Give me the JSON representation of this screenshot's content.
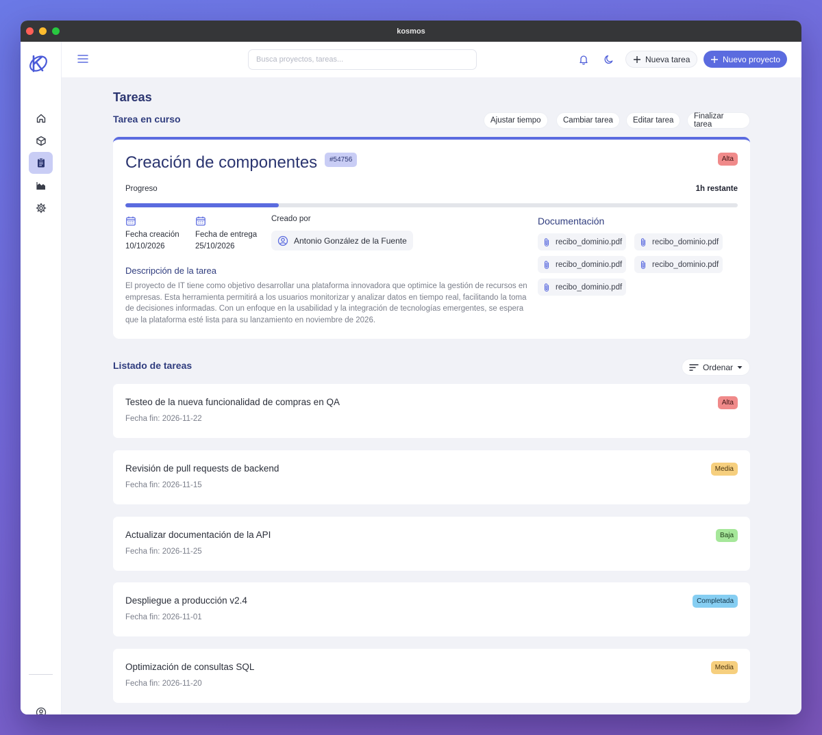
{
  "window": {
    "title": "kosmos"
  },
  "topbar": {
    "search_placeholder": "Busca proyectos, tareas...",
    "new_task_label": "Nueva tarea",
    "new_project_label": "Nuevo proyecto"
  },
  "sidebar": {
    "items": [
      {
        "name": "home",
        "icon": "home-icon",
        "active": false
      },
      {
        "name": "projects",
        "icon": "cube-icon",
        "active": false
      },
      {
        "name": "tasks",
        "icon": "clipboard-icon",
        "active": true
      },
      {
        "name": "reports",
        "icon": "chart-area-icon",
        "active": false
      },
      {
        "name": "settings",
        "icon": "gear-icon",
        "active": false
      }
    ],
    "account_icon": "user-circle-icon"
  },
  "page": {
    "title": "Tareas",
    "current_section": "Tarea en curso",
    "actions": [
      "Ajustar tiempo",
      "Cambiar tarea",
      "Editar tarea",
      "Finalizar tarea"
    ]
  },
  "current_task": {
    "title": "Creación de componentes",
    "id": "#54756",
    "priority": "Alta",
    "progress_label": "Progreso",
    "remaining": "1h restante",
    "progress_fraction": 0.25,
    "created_label": "Fecha creación",
    "created_date": "10/10/2026",
    "due_label": "Fecha de entrega",
    "due_date": "25/10/2026",
    "creator_label": "Creado por",
    "creator_name": "Antonio González de la Fuente",
    "description_title": "Descripción de la tarea",
    "description": "El proyecto de IT tiene como objetivo desarrollar una plataforma innovadora que optimice la gestión de recursos en empresas. Esta herramienta permitirá a los usuarios monitorizar y analizar datos en tiempo real, facilitando la toma de decisiones informadas. Con un enfoque en la usabilidad y la integración de tecnologías emergentes, se espera que la plataforma esté lista para su lanzamiento en noviembre de 2026.",
    "documentation_title": "Documentación",
    "documents": [
      "recibo_dominio.pdf",
      "recibo_dominio.pdf",
      "recibo_dominio.pdf",
      "recibo_dominio.pdf",
      "recibo_dominio.pdf"
    ]
  },
  "task_list": {
    "title": "Listado de tareas",
    "sort_label": "Ordenar",
    "tasks": [
      {
        "title": "Testeo de la nueva funcionalidad de compras en QA",
        "date": "Fecha fin: 2026-11-22",
        "priority": "Alta",
        "color": "#f08a8a"
      },
      {
        "title": "Revisión de pull requests de backend",
        "date": "Fecha fin: 2026-11-15",
        "priority": "Media",
        "color": "#f6cf7e"
      },
      {
        "title": "Actualizar documentación de la API",
        "date": "Fecha fin: 2026-11-25",
        "priority": "Baja",
        "color": "#a6e79a"
      },
      {
        "title": "Despliegue a producción v2.4",
        "date": "Fecha fin: 2026-11-01",
        "priority": "Completada",
        "color": "#86cef2"
      },
      {
        "title": "Optimización de consultas SQL",
        "date": "Fecha fin: 2026-11-20",
        "priority": "Media",
        "color": "#f6cf7e"
      }
    ]
  },
  "colors": {
    "accent": "#5b6bdf",
    "heading": "#2b3570",
    "active_nav": "#c9cdf5"
  }
}
